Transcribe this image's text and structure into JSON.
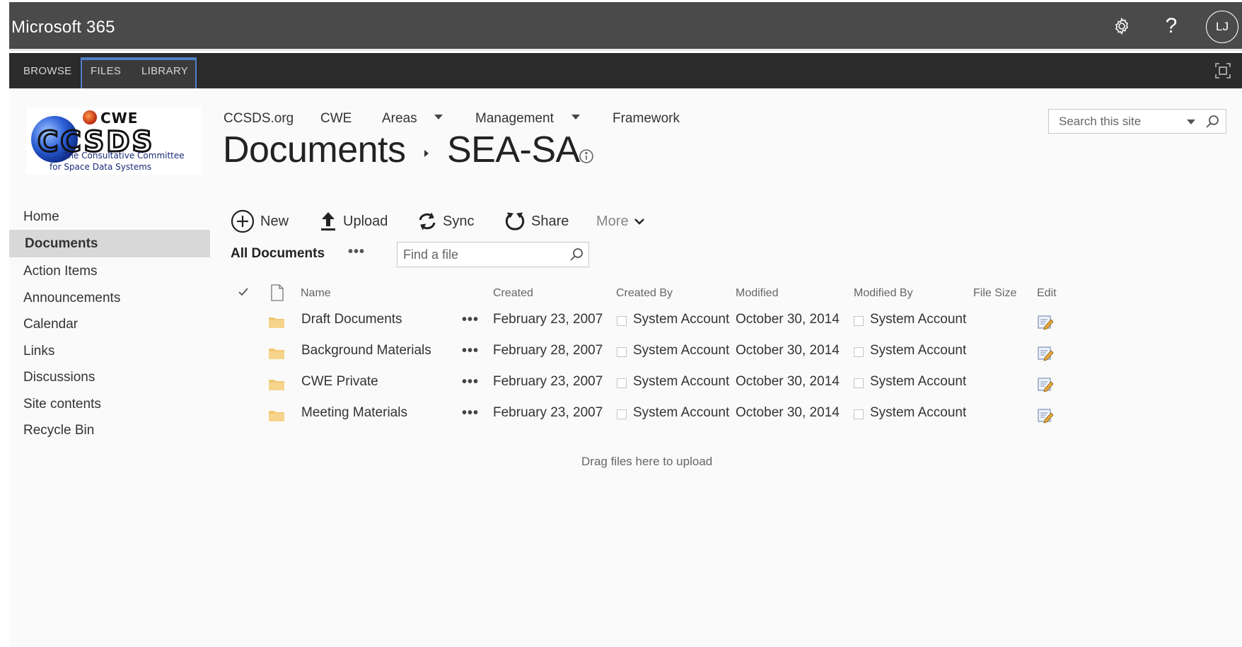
{
  "suite": {
    "title": "Microsoft 365",
    "avatar_initials": "LJ",
    "icons": [
      "gear-icon",
      "help-icon"
    ]
  },
  "ribbon": {
    "tabs": [
      "BROWSE",
      "FILES",
      "LIBRARY"
    ]
  },
  "site": {
    "logo": {
      "wordmark_top": "CWE",
      "wordmark_main": "CCSDS",
      "tagline_1": "The Consultative Committee",
      "tagline_2": "for Space Data Systems"
    },
    "topnav": [
      "CCSDS.org",
      "CWE",
      "Areas",
      "Management",
      "Framework"
    ],
    "title": "Documents",
    "subtitle": "SEA-SA",
    "search_placeholder": "Search this site"
  },
  "leftnav": {
    "items": [
      "Home",
      "Documents",
      "Action Items",
      "Announcements",
      "Calendar",
      "Links",
      "Discussions",
      "Site contents",
      "Recycle Bin"
    ],
    "selected": "Documents"
  },
  "commands": {
    "new": "New",
    "upload": "Upload",
    "sync": "Sync",
    "share": "Share",
    "more": "More"
  },
  "view": {
    "label": "All Documents",
    "dots": "•••",
    "find_placeholder": "Find a file"
  },
  "table": {
    "columns": {
      "name": "Name",
      "created": "Created",
      "created_by": "Created By",
      "modified": "Modified",
      "modified_by": "Modified By",
      "file_size": "File Size",
      "edit": "Edit"
    },
    "row_dots": "•••",
    "rows": [
      {
        "name": "Draft Documents",
        "created": "February 23, 2007",
        "created_by": "System Account",
        "modified": "October 30, 2014",
        "modified_by": "System Account"
      },
      {
        "name": "Background Materials",
        "created": "February 28, 2007",
        "created_by": "System Account",
        "modified": "October 30, 2014",
        "modified_by": "System Account"
      },
      {
        "name": "CWE Private",
        "created": "February 23, 2007",
        "created_by": "System Account",
        "modified": "October 30, 2014",
        "modified_by": "System Account"
      },
      {
        "name": "Meeting Materials",
        "created": "February 23, 2007",
        "created_by": "System Account",
        "modified": "October 30, 2014",
        "modified_by": "System Account"
      }
    ]
  },
  "drag_hint": "Drag files here to upload",
  "colors": {
    "suitebar": "#4a4a4a",
    "ribbon": "#2b2b2b",
    "ribbon_accent": "#4f80c9",
    "nav_selected": "#d8d8d8",
    "folder": "#f2c875"
  }
}
